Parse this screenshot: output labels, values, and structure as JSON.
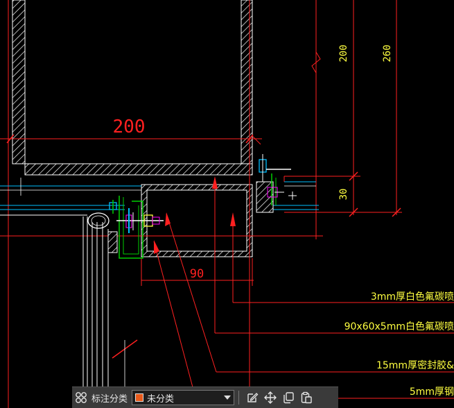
{
  "drawing": {
    "dimensions": {
      "width_top": "200",
      "width_bottom": "90",
      "height_upper": "200",
      "height_total": "260",
      "height_lower": "30"
    },
    "annotations": [
      "3mm厚白色氟碳喷",
      "90x60x5mm白色氟碳喷",
      "15mm厚密封胶&",
      "5mm厚钢"
    ],
    "colors": {
      "background": "#000000",
      "red": "#ff2020",
      "white": "#ffffff",
      "cyan": "#00bfff",
      "green": "#00d000",
      "yellow": "#ffff40",
      "magenta": "#ff00ff"
    }
  },
  "toolbar": {
    "grid_icon": "grid-icon",
    "label": "标注分类",
    "select_value": "未分类",
    "select_swatch": "#e85a1b",
    "tools": [
      "edit-icon",
      "move-icon",
      "copy-icon",
      "paste-icon"
    ]
  }
}
